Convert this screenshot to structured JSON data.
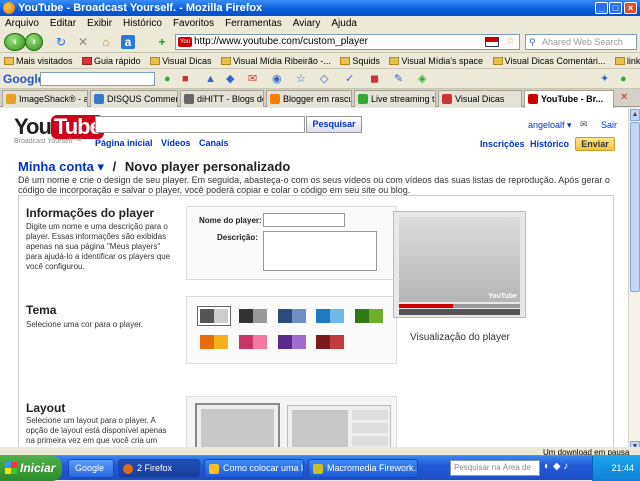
{
  "window": {
    "title": "YouTube - Broadcast Yourself. - Mozilla Firefox"
  },
  "menu": [
    "Arquivo",
    "Editar",
    "Exibir",
    "Histórico",
    "Favoritos",
    "Ferramentas",
    "Aviary",
    "Ajuda"
  ],
  "address": {
    "url": "http://www.youtube.com/custom_player"
  },
  "search_engine": {
    "placeholder": "Ahared Web Search"
  },
  "bookmarks": [
    "Mais visitados",
    "Guia rápido",
    "Visual Dicas",
    "Visual Mídia Ribeirão -...",
    "Squids",
    "Visual Mídia's space",
    "Visual Dicas Comentári...",
    "link:http://visualdicas...."
  ],
  "google_bar": {
    "logo": "Google"
  },
  "tabs": [
    {
      "label": "ImageShack® - ang..."
    },
    {
      "label": "DISQUS Comments |..."
    },
    {
      "label": "diHITT - Blogs do us..."
    },
    {
      "label": "Blogger em rascunh..."
    },
    {
      "label": "Live streaming traffc"
    },
    {
      "label": "Visual Dicas"
    },
    {
      "label": "YouTube - Br..."
    }
  ],
  "youtube": {
    "logo_you": "You",
    "logo_tube": "Tube",
    "slogan": "Broadcast Yourself ™",
    "search_button": "Pesquisar",
    "nav": [
      "Página inicial",
      "Vídeos",
      "Canais"
    ],
    "user": "angeloalf",
    "signout": "Sair",
    "subscriptions": "Inscrições",
    "history": "Histórico",
    "upload": "Enviar",
    "breadcrumb_account": "Minha conta",
    "breadcrumb_sep": "/",
    "page_title": "Novo player personalizado",
    "intro": "Dê um nome e crie o design de seu player. Em seguida, abasteça-o com os seus vídeos ou com vídeos das suas listas de reprodução. Após gerar o código de incorporação e salvar o player, você poderá copiar e colar o código em seu site ou blog.",
    "info": {
      "heading": "Informações do player",
      "desc": "Digite um nome e uma descrição para o player. Essas informações são exibidas apenas na sua página \"Meus players\" para ajudá-lo a identificar os players que você configurou.",
      "name_label": "Nome do player:",
      "desc_label": "Descrição:"
    },
    "theme": {
      "heading": "Tema",
      "desc": "Selecione uma cor para o player.",
      "swatches": [
        [
          "#555555",
          "#cccccc"
        ],
        [
          "#333333",
          "#999999"
        ],
        [
          "#2d4a7a",
          "#6d8fc2"
        ],
        [
          "#1f7ac2",
          "#6fb8e8"
        ],
        [
          "#2e7a12",
          "#6fb02a"
        ],
        [
          "#e86c0a",
          "#f5b21a"
        ],
        [
          "#cc3366",
          "#f07aa0"
        ],
        [
          "#5c2a8a",
          "#a06ad0"
        ],
        [
          "#7a1a1a",
          "#c23a3a"
        ]
      ]
    },
    "preview_label": "Visualização do player",
    "preview_logo": "YouTube",
    "layout": {
      "heading": "Layout",
      "desc": "Selecione um layout para o player. A opção de layout está disponível apenas na primeira vez em que você cria um player. Após escolher um layout e salvar o player, ..."
    }
  },
  "status": {
    "download": "Um download em pausa"
  },
  "taskbar": {
    "start": "Iniciar",
    "items": [
      "Google",
      "2 Firefox",
      "Como colocar uma list...",
      "Macromedia Firework..."
    ],
    "search_placeholder": "Pesquisar na Área de",
    "time": "21:44"
  }
}
